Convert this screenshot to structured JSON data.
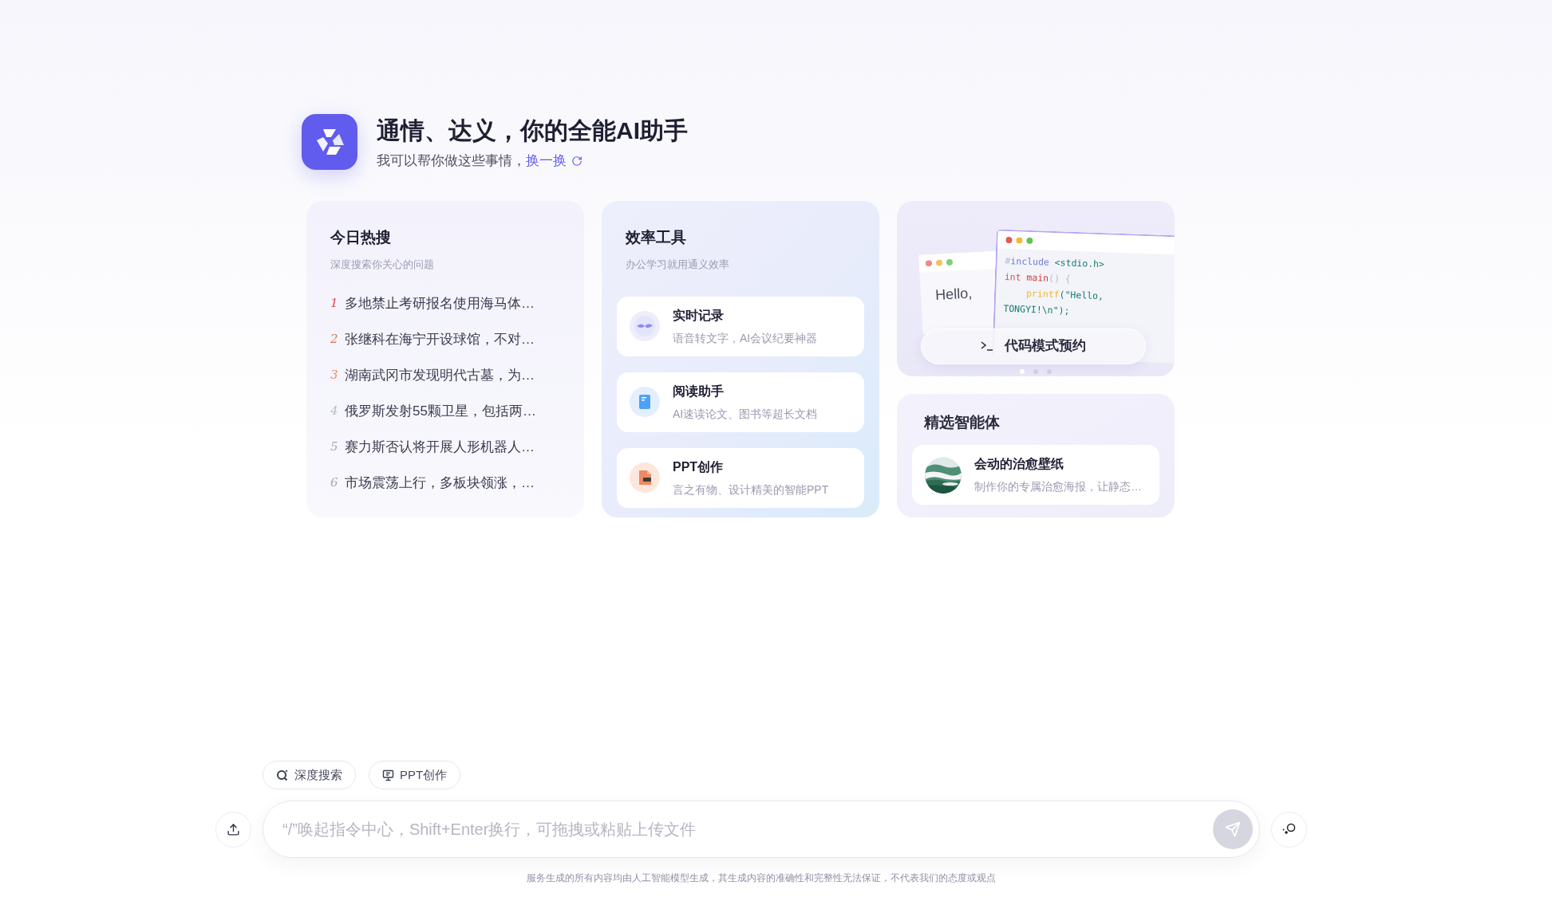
{
  "header": {
    "title": "通情、达义，你的全能AI助手",
    "subtitle": "我可以帮你做这些事情，",
    "refresh_link": "换一换"
  },
  "hot_search": {
    "title": "今日热搜",
    "subtitle": "深度搜索你关心的问题",
    "items": [
      {
        "rank": "1",
        "color": "#e5484d",
        "text": "多地禁止考研报名使用海马体…"
      },
      {
        "rank": "2",
        "color": "#e0775a",
        "text": "张继科在海宁开设球馆，不对…"
      },
      {
        "rank": "3",
        "color": "#e8906a",
        "text": "湖南武冈市发现明代古墓，为…"
      },
      {
        "rank": "4",
        "color": "#b8bccb",
        "text": "俄罗斯发射55颗卫星，包括两…"
      },
      {
        "rank": "5",
        "color": "#a4a8ba",
        "text": "赛力斯否认将开展人形机器人…"
      },
      {
        "rank": "6",
        "color": "#a4a8ba",
        "text": "市场震荡上行，多板块领涨，…"
      }
    ]
  },
  "tools": {
    "title": "效率工具",
    "subtitle": "办公学习就用通义效率",
    "items": [
      {
        "kind": "record",
        "name": "实时记录",
        "desc": "语音转文字，AI会议纪要神器"
      },
      {
        "kind": "reader",
        "name": "阅读助手",
        "desc": "AI速读论文、图书等超长文档"
      },
      {
        "kind": "ppt",
        "name": "PPT创作",
        "desc": "言之有物、设计精美的智能PPT"
      }
    ]
  },
  "code_promo": {
    "back_window_text": "Hello,",
    "code_lines": [
      {
        "indent": false,
        "tokens": [
          {
            "kind": "punct",
            "text": "#"
          },
          {
            "kind": "keyword",
            "text": "include"
          },
          {
            "kind": "plain",
            "text": "<stdio.h>",
            "gap": true
          }
        ]
      },
      {
        "indent": false,
        "tokens": [
          {
            "kind": "type",
            "text": "int"
          },
          {
            "kind": "func",
            "text": "main",
            "gap": true
          },
          {
            "kind": "punct",
            "text": "() {"
          }
        ]
      },
      {
        "indent": true,
        "tokens": [
          {
            "kind": "call",
            "text": "printf"
          },
          {
            "kind": "plain",
            "text": "(\"Hello,"
          }
        ]
      },
      {
        "indent": false,
        "tokens": [
          {
            "kind": "plain",
            "text": "TONGYI!\\n\");"
          }
        ]
      }
    ],
    "button": "代码模式预约",
    "carousel_dots": [
      {
        "selected": true
      },
      {
        "selected": false
      },
      {
        "selected": false
      }
    ]
  },
  "agents": {
    "title": "精选智能体",
    "items": [
      {
        "name": "会动的治愈壁纸",
        "desc": "制作你的专属治愈海报，让静态…"
      }
    ]
  },
  "quick_actions": [
    {
      "kind": "search",
      "label": "深度搜索"
    },
    {
      "kind": "ppt",
      "label": "PPT创作"
    }
  ],
  "input": {
    "placeholder": "“/”唤起指令中心，Shift+Enter换行，可拖拽或粘贴上传文件"
  },
  "disclaimer": "服务生成的所有内容均由人工智能模型生成，其生成内容的准确性和完整性无法保证，不代表我们的态度或观点"
}
